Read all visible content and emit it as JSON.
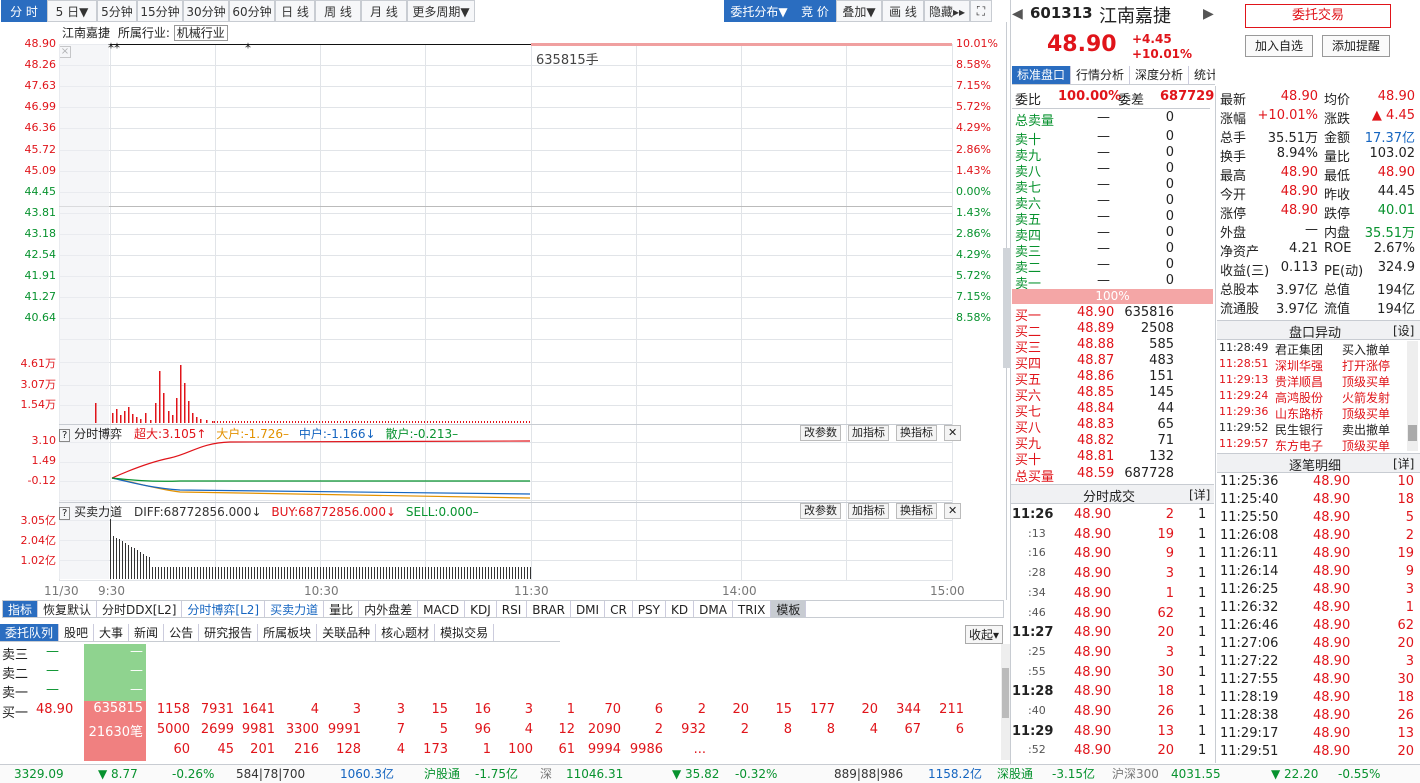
{
  "toolbar": {
    "left": [
      "分 时",
      "5 日▼",
      "5分钟",
      "15分钟",
      "30分钟",
      "60分钟",
      "日 线",
      "周 线",
      "月 线",
      "更多周期▼"
    ],
    "right": [
      "委托分布▼",
      "竞 价",
      "叠加▼",
      "画 线",
      "隐藏▸▸",
      "⛶"
    ]
  },
  "chart_header": {
    "name": "江南嘉捷",
    "industry_label": "所属行业:",
    "industry": "机械行业"
  },
  "price_axis": {
    "left": [
      "48.90",
      "48.26",
      "47.63",
      "46.99",
      "46.36",
      "45.72",
      "45.09",
      "44.45",
      "43.81",
      "43.18",
      "42.54",
      "41.91",
      "41.27",
      "40.64"
    ],
    "right": [
      "10.01%",
      "8.58%",
      "7.15%",
      "5.72%",
      "4.29%",
      "2.86%",
      "1.43%",
      "0.00%",
      "1.43%",
      "2.86%",
      "4.29%",
      "5.72%",
      "7.15%",
      "8.58%"
    ]
  },
  "hands_label": "635815手",
  "volume_axis": [
    "4.61万",
    "3.07万",
    "1.54万"
  ],
  "time_axis": [
    "11/30",
    "9:30",
    "10:30",
    "11:30",
    "14:00",
    "15:00"
  ],
  "game_panel": {
    "title": "分时博弈",
    "items": [
      {
        "t": "超大:3.105↑"
      },
      {
        "t": "大户:-1.726–"
      },
      {
        "t": "中户:-1.166↓"
      },
      {
        "t": "散户:-0.213–"
      }
    ],
    "axis": [
      "3.10",
      "1.49",
      "-0.12"
    ],
    "buttons": [
      "改参数",
      "加指标",
      "换指标",
      "✕"
    ]
  },
  "force_panel": {
    "title": "买卖力道",
    "items": [
      "DIFF:68772856.000↓",
      "BUY:68772856.000↓",
      "SELL:0.000–"
    ],
    "axis": [
      "3.05亿",
      "2.04亿",
      "1.02亿"
    ],
    "buttons": [
      "改参数",
      "加指标",
      "换指标",
      "✕"
    ]
  },
  "indicator_tabs": [
    "指标",
    "恢复默认",
    "分时DDX[L2]",
    "分时博弈[L2]",
    "买卖力道",
    "量比",
    "内外盘差",
    "MACD",
    "KDJ",
    "RSI",
    "BRAR",
    "DMI",
    "CR",
    "PSY",
    "KD",
    "DMA",
    "TRIX",
    "模板"
  ],
  "bottom_tabs": [
    "委托队列",
    "股吧",
    "大事",
    "新闻",
    "公告",
    "研究报告",
    "所属板块",
    "关联品种",
    "核心题材",
    "模拟交易"
  ],
  "collapse_label": "收起▾",
  "queue": {
    "sell": [
      {
        "label": "卖三",
        "price": "—",
        "vol": "—"
      },
      {
        "label": "卖二",
        "price": "—",
        "vol": "—"
      },
      {
        "label": "卖一",
        "price": "—",
        "vol": "—"
      }
    ],
    "buy_label": "买一",
    "buy_price": "48.90",
    "buy_vol": "635815",
    "buy_count": "21630笔",
    "rows": [
      [
        "1158",
        "7931",
        "1641",
        "4",
        "3",
        "3",
        "15",
        "16",
        "3",
        "1",
        "70",
        "6",
        "2",
        "20",
        "15",
        "177",
        "20",
        "344",
        "211"
      ],
      [
        "5000",
        "2699",
        "9981",
        "3300",
        "9991",
        "7",
        "5",
        "96",
        "4",
        "12",
        "2090",
        "2",
        "932",
        "2",
        "8",
        "8",
        "4",
        "67",
        "6"
      ],
      [
        "60",
        "45",
        "201",
        "216",
        "128",
        "4",
        "173",
        "1",
        "100",
        "61",
        "9994",
        "9986",
        "..."
      ]
    ]
  },
  "statusbar": [
    {
      "t": "3329.09",
      "c": "grn"
    },
    {
      "t": "▼ 8.77",
      "c": "grn"
    },
    {
      "t": "-0.26%",
      "c": "grn"
    },
    {
      "t": "584|78|700",
      "c": "mix"
    },
    {
      "t": "1060.3亿",
      "c": "blu"
    },
    {
      "t": "沪股通",
      "c": "grn"
    },
    {
      "t": "-1.75亿",
      "c": "grn"
    },
    {
      "t": "深",
      "c": "gry"
    },
    {
      "t": "11046.31",
      "c": "grn"
    },
    {
      "t": "▼ 35.82",
      "c": "grn"
    },
    {
      "t": "-0.32%",
      "c": "grn"
    },
    {
      "t": "889|88|986",
      "c": "mix"
    },
    {
      "t": "1158.2亿",
      "c": "blu"
    },
    {
      "t": "深股通",
      "c": "grn"
    },
    {
      "t": "-3.15亿",
      "c": "grn"
    },
    {
      "t": "沪深300",
      "c": "gry"
    },
    {
      "t": "4031.55",
      "c": "grn"
    },
    {
      "t": "▼ 22.20",
      "c": "grn"
    },
    {
      "t": "-0.55%",
      "c": "grn"
    }
  ],
  "stock": {
    "code": "601313",
    "name": "江南嘉捷",
    "price": "48.90",
    "change": "+4.45",
    "pct": "+10.01%",
    "btn_trade": "委托交易",
    "btn_watch": "加入自选",
    "btn_alert": "添加提醒"
  },
  "order_tabs": [
    "标准盘口",
    "行情分析",
    "深度分析",
    "统计明细"
  ],
  "order_book": {
    "wb_label": "委比",
    "wb": "100.00%",
    "wc_label": "委差",
    "wc": "687729",
    "total_sell_label": "总卖量",
    "total_sell_price": "—",
    "total_sell_vol": "0",
    "sells": [
      {
        "l": "卖十",
        "p": "—",
        "v": "0"
      },
      {
        "l": "卖九",
        "p": "—",
        "v": "0"
      },
      {
        "l": "卖八",
        "p": "—",
        "v": "0"
      },
      {
        "l": "卖七",
        "p": "—",
        "v": "0"
      },
      {
        "l": "卖六",
        "p": "—",
        "v": "0"
      },
      {
        "l": "卖五",
        "p": "—",
        "v": "0"
      },
      {
        "l": "卖四",
        "p": "—",
        "v": "0"
      },
      {
        "l": "卖三",
        "p": "—",
        "v": "0"
      },
      {
        "l": "卖二",
        "p": "—",
        "v": "0"
      },
      {
        "l": "卖一",
        "p": "—",
        "v": "0"
      }
    ],
    "bar": "100%",
    "buys": [
      {
        "l": "买一",
        "p": "48.90",
        "v": "635816"
      },
      {
        "l": "买二",
        "p": "48.89",
        "v": "2508"
      },
      {
        "l": "买三",
        "p": "48.88",
        "v": "585"
      },
      {
        "l": "买四",
        "p": "48.87",
        "v": "483"
      },
      {
        "l": "买五",
        "p": "48.86",
        "v": "151"
      },
      {
        "l": "买六",
        "p": "48.85",
        "v": "145"
      },
      {
        "l": "买七",
        "p": "48.84",
        "v": "44"
      },
      {
        "l": "买八",
        "p": "48.83",
        "v": "65"
      },
      {
        "l": "买九",
        "p": "48.82",
        "v": "71"
      },
      {
        "l": "买十",
        "p": "48.81",
        "v": "132"
      }
    ],
    "total_buy_label": "总买量",
    "total_buy_price": "48.59",
    "total_buy_vol": "687728"
  },
  "trades_title": "分时成交",
  "detail": "[详]",
  "trades": [
    {
      "t": "11:26",
      "p": "48.90",
      "v": "2",
      "n": "1"
    },
    {
      "t": ":13",
      "p": "48.90",
      "v": "19",
      "n": "1"
    },
    {
      "t": ":16",
      "p": "48.90",
      "v": "9",
      "n": "1"
    },
    {
      "t": ":28",
      "p": "48.90",
      "v": "3",
      "n": "1"
    },
    {
      "t": ":34",
      "p": "48.90",
      "v": "1",
      "n": "1"
    },
    {
      "t": ":46",
      "p": "48.90",
      "v": "62",
      "n": "1"
    },
    {
      "t": "11:27",
      "p": "48.90",
      "v": "20",
      "n": "1"
    },
    {
      "t": ":25",
      "p": "48.90",
      "v": "3",
      "n": "1"
    },
    {
      "t": ":55",
      "p": "48.90",
      "v": "30",
      "n": "1"
    },
    {
      "t": "11:28",
      "p": "48.90",
      "v": "18",
      "n": "1"
    },
    {
      "t": ":40",
      "p": "48.90",
      "v": "26",
      "n": "1"
    },
    {
      "t": "11:29",
      "p": "48.90",
      "v": "13",
      "n": "1"
    },
    {
      "t": ":52",
      "p": "48.90",
      "v": "20",
      "n": "1"
    }
  ],
  "stats": [
    {
      "a": "最新",
      "b": "48.90",
      "bc": "red",
      "c": "均价",
      "d": "48.90",
      "dc": "red"
    },
    {
      "a": "涨幅",
      "b": "+10.01%",
      "bc": "red",
      "c": "涨跌",
      "d": "▲ 4.45",
      "dc": "red"
    },
    {
      "a": "总手",
      "b": "35.51万",
      "bc": "blk",
      "c": "金额",
      "d": "17.37亿",
      "dc": "blu"
    },
    {
      "a": "换手",
      "b": "8.94%",
      "bc": "blk",
      "c": "量比",
      "d": "103.02",
      "dc": "blk"
    },
    {
      "a": "最高",
      "b": "48.90",
      "bc": "red",
      "c": "最低",
      "d": "48.90",
      "dc": "red"
    },
    {
      "a": "今开",
      "b": "48.90",
      "bc": "red",
      "c": "昨收",
      "d": "44.45",
      "dc": "blk"
    },
    {
      "a": "涨停",
      "b": "48.90",
      "bc": "red",
      "c": "跌停",
      "d": "40.01",
      "dc": "grn"
    },
    {
      "a": "外盘",
      "b": "—",
      "bc": "blk",
      "c": "内盘",
      "d": "35.51万",
      "dc": "grn"
    },
    {
      "a": "净资产",
      "b": "4.21",
      "bc": "blk",
      "c": "ROE",
      "d": "2.67%",
      "dc": "blk"
    },
    {
      "a": "收益(三)",
      "b": "0.113",
      "bc": "blk",
      "c": "PE(动)",
      "d": "324.9",
      "dc": "blk"
    },
    {
      "a": "总股本",
      "b": "3.97亿",
      "bc": "blk",
      "c": "总值",
      "d": "194亿",
      "dc": "blk"
    },
    {
      "a": "流通股",
      "b": "3.97亿",
      "bc": "blk",
      "c": "流值",
      "d": "194亿",
      "dc": "blk"
    }
  ],
  "anomaly_title": "盘口异动",
  "anomaly_set": "[设]",
  "anomalies": [
    {
      "t": "11:28:49",
      "n": "君正集团",
      "e": "买入撤单",
      "c": "blk"
    },
    {
      "t": "11:28:51",
      "n": "深圳华强",
      "e": "打开涨停",
      "c": "red"
    },
    {
      "t": "11:29:13",
      "n": "贵洋顺昌",
      "e": "顶级买单",
      "c": "red"
    },
    {
      "t": "11:29:24",
      "n": "高鸿股份",
      "e": "火箭发射",
      "c": "red"
    },
    {
      "t": "11:29:36",
      "n": "山东路桥",
      "e": "顶级买单",
      "c": "red"
    },
    {
      "t": "11:29:52",
      "n": "民生银行",
      "e": "卖出撤单",
      "c": "blk"
    },
    {
      "t": "11:29:57",
      "n": "东方电子",
      "e": "顶级买单",
      "c": "red"
    }
  ],
  "tick_title": "逐笔明细",
  "ticks": [
    {
      "t": "11:25:36",
      "p": "48.90",
      "v": "10"
    },
    {
      "t": "11:25:40",
      "p": "48.90",
      "v": "18"
    },
    {
      "t": "11:25:50",
      "p": "48.90",
      "v": "5"
    },
    {
      "t": "11:26:08",
      "p": "48.90",
      "v": "2"
    },
    {
      "t": "11:26:11",
      "p": "48.90",
      "v": "19"
    },
    {
      "t": "11:26:14",
      "p": "48.90",
      "v": "9"
    },
    {
      "t": "11:26:25",
      "p": "48.90",
      "v": "3"
    },
    {
      "t": "11:26:32",
      "p": "48.90",
      "v": "1"
    },
    {
      "t": "11:26:46",
      "p": "48.90",
      "v": "62"
    },
    {
      "t": "11:27:06",
      "p": "48.90",
      "v": "20"
    },
    {
      "t": "11:27:22",
      "p": "48.90",
      "v": "3"
    },
    {
      "t": "11:27:55",
      "p": "48.90",
      "v": "30"
    },
    {
      "t": "11:28:19",
      "p": "48.90",
      "v": "18"
    },
    {
      "t": "11:28:38",
      "p": "48.90",
      "v": "26"
    },
    {
      "t": "11:29:17",
      "p": "48.90",
      "v": "13"
    },
    {
      "t": "11:29:51",
      "p": "48.90",
      "v": "20"
    }
  ],
  "volume_bars": [
    3,
    0,
    0,
    0,
    0,
    0,
    0,
    1,
    0,
    0,
    0,
    0,
    0,
    0,
    0,
    0,
    0,
    0,
    0,
    0,
    0,
    0,
    0,
    0,
    0,
    0,
    0,
    0,
    0,
    0,
    0,
    0,
    0,
    0,
    0,
    0,
    0,
    0,
    0,
    0,
    0,
    0,
    0,
    0,
    0,
    0,
    0,
    0,
    0,
    0,
    0,
    0,
    0,
    0,
    0,
    0,
    0,
    0,
    0,
    0,
    0,
    0,
    0,
    0,
    0,
    0,
    0,
    0,
    0,
    0,
    0,
    0,
    0,
    0,
    0,
    0,
    0,
    0,
    0,
    0,
    0,
    0,
    0,
    0,
    0,
    0,
    0,
    0,
    0,
    0,
    0,
    0,
    0,
    0,
    0,
    0,
    0,
    0,
    0,
    0,
    0,
    0,
    0,
    0,
    0,
    0,
    0,
    0,
    0,
    0,
    0,
    0,
    0,
    0,
    0,
    0,
    0,
    0,
    0,
    0,
    0,
    0,
    0,
    0,
    0,
    0,
    0,
    0,
    0,
    0,
    0,
    0,
    0,
    0,
    0,
    0,
    0,
    0,
    0,
    0,
    0,
    0,
    0,
    0,
    0,
    0,
    0,
    0,
    0,
    0,
    0,
    0,
    0,
    0,
    0,
    0,
    0,
    0,
    0,
    0,
    0,
    0,
    0,
    0,
    0,
    0,
    0,
    0,
    0,
    0,
    0,
    0,
    0,
    0,
    0,
    0,
    0,
    0,
    0,
    0,
    0,
    0,
    0,
    0,
    0,
    0,
    0,
    0,
    0,
    0,
    0,
    0,
    0,
    0,
    0,
    0,
    0,
    0,
    0,
    0,
    0,
    0,
    0,
    0,
    0,
    0,
    0,
    0,
    0,
    0,
    0,
    0,
    0,
    0,
    0,
    0,
    0,
    0,
    0,
    0,
    0,
    0,
    0,
    0,
    0,
    0,
    0,
    0,
    0,
    0,
    0,
    0,
    0,
    0,
    0,
    0,
    0,
    0,
    0,
    0,
    0,
    0,
    0,
    0,
    0,
    0,
    0,
    0,
    0,
    0,
    0,
    0,
    0,
    0,
    0,
    0,
    0,
    0,
    0,
    0,
    0,
    0
  ]
}
